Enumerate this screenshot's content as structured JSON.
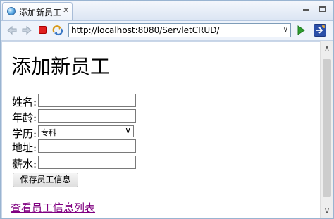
{
  "tab": {
    "title": "添加新员工",
    "close": "✕"
  },
  "toolbar": {
    "url": "http://localhost:8080/ServletCRUD/"
  },
  "page": {
    "heading": "添加新员工",
    "fields": [
      {
        "label": "姓名:",
        "value": ""
      },
      {
        "label": "年龄:",
        "value": ""
      },
      {
        "label": "学历:",
        "value": "专科"
      },
      {
        "label": "地址:",
        "value": ""
      },
      {
        "label": "薪水:",
        "value": ""
      }
    ],
    "save_button": "保存员工信息",
    "list_link": "查看员工信息列表"
  },
  "colors": {
    "link": "#800080",
    "stop": "#e02020",
    "go": "#2e9e2e",
    "chrome": "#dfe8f6"
  },
  "icons": [
    "globe-icon",
    "back-arrow-icon",
    "forward-arrow-icon",
    "stop-icon",
    "refresh-icon",
    "go-icon",
    "open-external-icon",
    "minimize-icon",
    "maximize-icon"
  ]
}
